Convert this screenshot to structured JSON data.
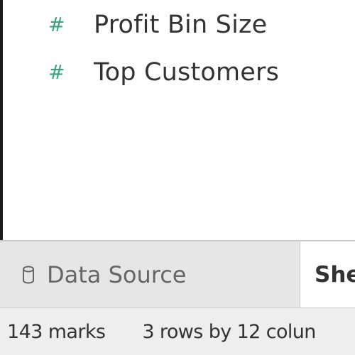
{
  "parameters": {
    "items": [
      {
        "label": "Profit Bin Size",
        "icon": "hash-icon"
      },
      {
        "label": "Top Customers",
        "icon": "hash-icon"
      }
    ],
    "icon_color": "#3aa57a"
  },
  "tabs": {
    "data_source_label": "Data Source",
    "data_source_icon": "database-icon",
    "sheet_label": "She"
  },
  "status": {
    "marks": "143 marks",
    "rows_cols": "3 rows by 12 colun"
  }
}
